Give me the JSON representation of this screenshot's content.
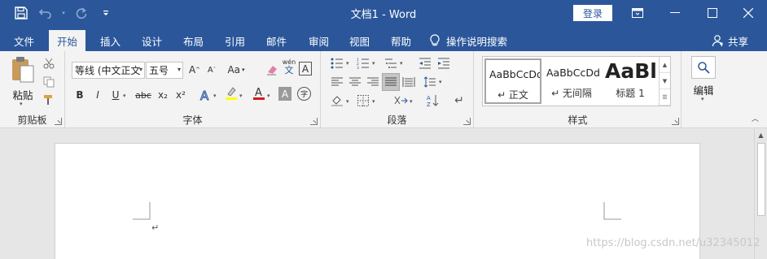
{
  "titlebar": {
    "title": "文档1  -  Word",
    "login_label": "登录",
    "qat": {
      "save": "save-icon",
      "undo": "undo-icon",
      "redo": "redo-icon",
      "customize": "customize-icon"
    }
  },
  "tabs": [
    {
      "label": "文件"
    },
    {
      "label": "开始"
    },
    {
      "label": "插入"
    },
    {
      "label": "设计"
    },
    {
      "label": "布局"
    },
    {
      "label": "引用"
    },
    {
      "label": "邮件"
    },
    {
      "label": "审阅"
    },
    {
      "label": "视图"
    },
    {
      "label": "帮助"
    }
  ],
  "tellme_label": "操作说明搜索",
  "share_label": "共享",
  "ribbon": {
    "clipboard": {
      "label": "剪贴板",
      "paste_label": "粘贴"
    },
    "font": {
      "label": "字体",
      "font_name": "等线 (中文正文",
      "font_size": "五号",
      "aa_label": "Aa",
      "pinyin_top": "wén",
      "pinyin_bottom": "文",
      "bold": "B",
      "italic": "I",
      "underline": "U",
      "strike": "abc",
      "sub": "x₂",
      "sup": "x²",
      "border_a": "A",
      "enc": "字"
    },
    "paragraph": {
      "label": "段落"
    },
    "styles": {
      "label": "样式",
      "items": [
        {
          "sample": "AaBbCcDd",
          "name": "↵ 正文"
        },
        {
          "sample": "AaBbCcDd",
          "name": "↵ 无间隔"
        },
        {
          "sample": "AaBl",
          "name": "标题 1"
        }
      ]
    },
    "editing": {
      "label": "编辑"
    }
  },
  "document": {
    "paragraph_mark": "↵"
  },
  "watermark": "https://blog.csdn.net/u32345012",
  "colors": {
    "brand": "#2b579a",
    "font_color_bar": "#d7191c",
    "highlight_bar": "#ffff00"
  }
}
